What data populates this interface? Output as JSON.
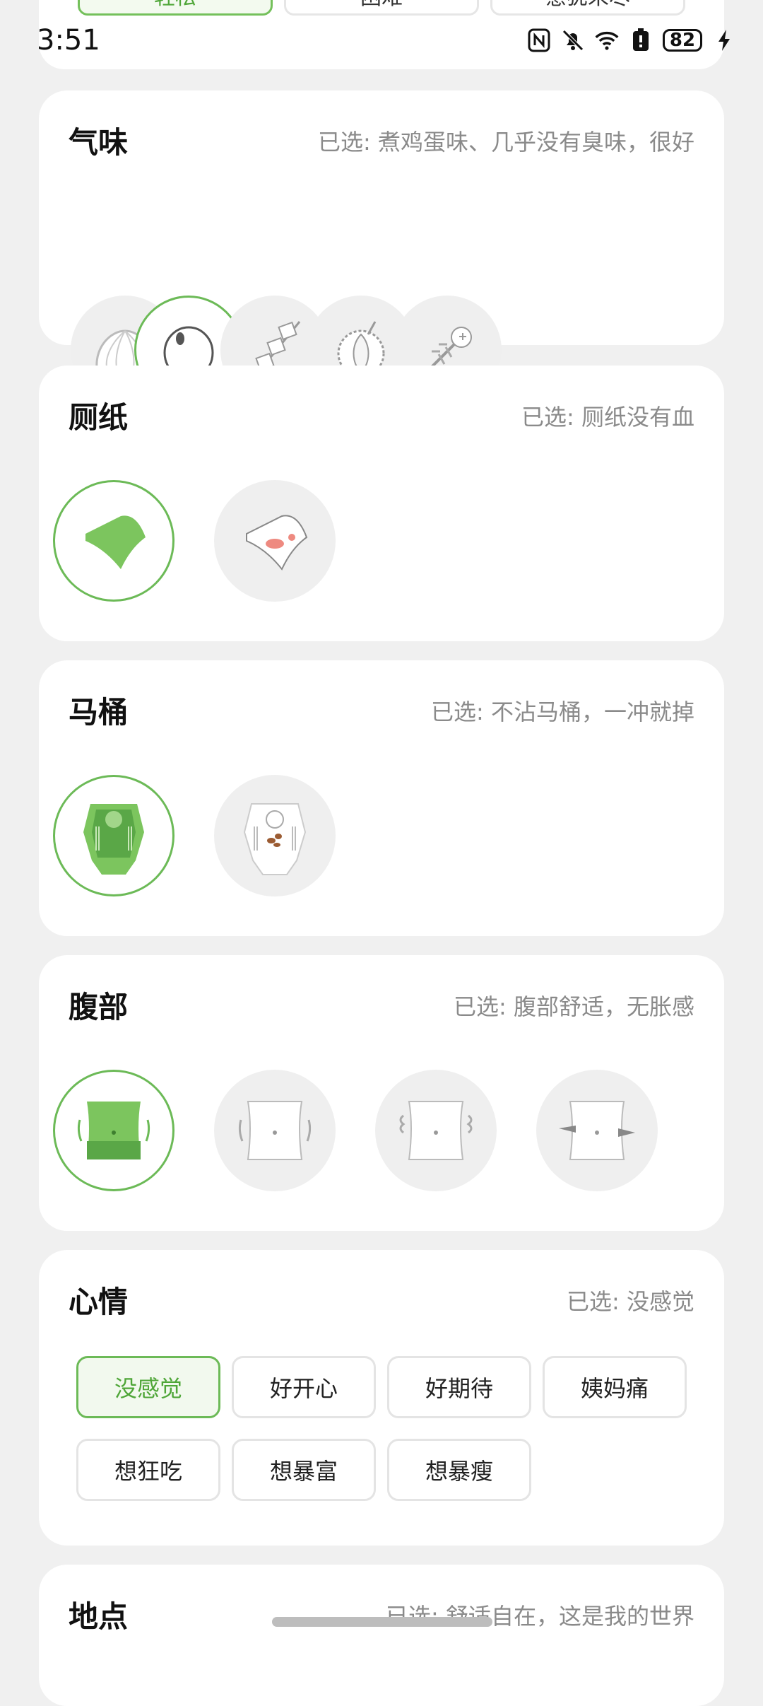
{
  "status": {
    "time": "3:51",
    "battery": "82",
    "icons": [
      "nfc-icon",
      "bell-off-icon",
      "wifi-icon",
      "battery-saver-icon",
      "battery-icon",
      "charging-bolt-icon"
    ]
  },
  "ease": {
    "options": [
      "轻松",
      "困难",
      "意犹未尽"
    ],
    "selected_index": 0
  },
  "smell": {
    "title": "气味",
    "selected": "已选: 煮鸡蛋味、几乎没有臭味，很好",
    "options": [
      "steamed-bun-icon",
      "boiled-egg-icon",
      "skewer-icon",
      "durian-icon",
      "fish-bone-icon"
    ],
    "selected_index": 1
  },
  "paper": {
    "title": "厕纸",
    "selected": "已选: 厕纸没有血",
    "options": [
      "clean-paper-icon",
      "bloody-paper-icon"
    ],
    "selected_index": 0
  },
  "toilet": {
    "title": "马桶",
    "selected": "已选: 不沾马桶，一冲就掉",
    "options": [
      "clean-toilet-icon",
      "dirty-toilet-icon"
    ],
    "selected_index": 0
  },
  "belly": {
    "title": "腹部",
    "selected": "已选: 腹部舒适，无胀感",
    "options": [
      "belly-comfortable-icon",
      "belly-bloated-icon",
      "belly-gas-icon",
      "belly-cramp-icon"
    ],
    "selected_index": 0
  },
  "mood": {
    "title": "心情",
    "selected": "已选: 没感觉",
    "chips": [
      "没感觉",
      "好开心",
      "好期待",
      "姨妈痛",
      "想狂吃",
      "想暴富",
      "想暴瘦"
    ],
    "selected_index": 0
  },
  "place": {
    "title": "地点",
    "selected": "已选: 舒适自在，这是我的世界"
  },
  "colors": {
    "accent": "#6cba57",
    "accent_fill": "#7cc55e",
    "background": "#f0f0f0",
    "card": "#ffffff"
  }
}
